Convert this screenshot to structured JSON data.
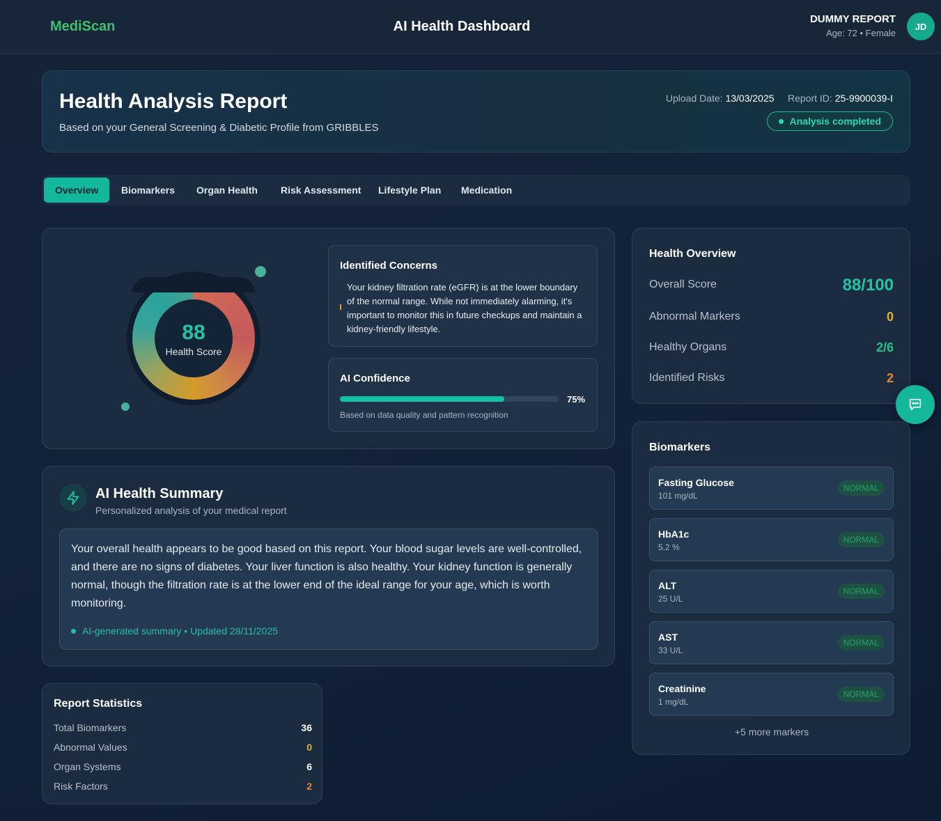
{
  "topbar": {
    "brand": "MediScan",
    "title": "AI Health Dashboard",
    "user_name": "DUMMY REPORT",
    "user_meta": "Age: 72 • Female",
    "avatar_initials": "JD"
  },
  "report": {
    "title": "Health Analysis Report",
    "subtitle": "Based on your General Screening & Diabetic Profile from GRIBBLES",
    "upload_label": "Upload Date:",
    "upload_date": "13/03/2025",
    "id_label": "Report ID:",
    "report_id": "25-9900039-I",
    "status": "Analysis completed"
  },
  "tabs": [
    "Overview",
    "Biomarkers",
    "Organ Health",
    "Risk Assessment",
    "Lifestyle Plan",
    "Medication"
  ],
  "active_tab": "Overview",
  "score": {
    "value": "88",
    "label": "Health Score"
  },
  "concerns": {
    "title": "Identified Concerns",
    "text": "Your kidney filtration rate (eGFR) is at the lower boundary of the normal range. While not immediately alarming, it's important to monitor this in future checkups and maintain a kidney-friendly lifestyle."
  },
  "confidence": {
    "title": "AI Confidence",
    "percent": 75,
    "percent_label": "75%",
    "note": "Based on data quality and pattern recognition"
  },
  "summary": {
    "title": "AI Health Summary",
    "subtitle": "Personalized analysis of your medical report",
    "text": "Your overall health appears to be good based on this report. Your blood sugar levels are well-controlled, and there are no signs of diabetes. Your liver function is also healthy. Your kidney function is generally normal, though the filtration rate is at the lower end of the ideal range for your age, which is worth monitoring.",
    "footer": "AI-generated summary • Updated 28/11/2025"
  },
  "stats": {
    "title": "Report Statistics",
    "rows": [
      {
        "label": "Total Biomarkers",
        "value": "36",
        "color": "#ffffff"
      },
      {
        "label": "Abnormal Values",
        "value": "0",
        "color": "#e3b22a"
      },
      {
        "label": "Organ Systems",
        "value": "6",
        "color": "#ffffff"
      },
      {
        "label": "Risk Factors",
        "value": "2",
        "color": "#e8862a"
      }
    ]
  },
  "overview": {
    "title": "Health Overview",
    "rows": [
      {
        "label": "Overall Score",
        "value": "88/100",
        "color": "#22c3a6"
      },
      {
        "label": "Abnormal Markers",
        "value": "0",
        "color": "#e3b22a"
      },
      {
        "label": "Healthy Organs",
        "value": "2/6",
        "color": "#22c38a"
      },
      {
        "label": "Identified Risks",
        "value": "2",
        "color": "#e8862a"
      }
    ]
  },
  "biomarkers": {
    "title": "Biomarkers",
    "items": [
      {
        "name": "Fasting Glucose",
        "value": "101 mg/dL",
        "status": "NORMAL"
      },
      {
        "name": "HbA1c",
        "value": "5.2 %",
        "status": "NORMAL"
      },
      {
        "name": "ALT",
        "value": "25 U/L",
        "status": "NORMAL"
      },
      {
        "name": "AST",
        "value": "33 U/L",
        "status": "NORMAL"
      },
      {
        "name": "Creatinine",
        "value": "1 mg/dL",
        "status": "NORMAL"
      }
    ],
    "more": "+5 more markers"
  }
}
